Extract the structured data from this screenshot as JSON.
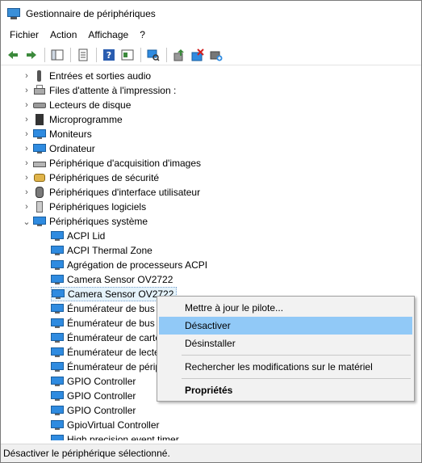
{
  "window": {
    "title": "Gestionnaire de périphériques"
  },
  "menubar": {
    "items": [
      "Fichier",
      "Action",
      "Affichage",
      "?"
    ]
  },
  "toolbar": {
    "buttons": [
      "back-icon",
      "forward-icon",
      "show-hide-tree-icon",
      "properties-icon",
      "help-icon",
      "action-icon",
      "scan-hardware-icon",
      "update-driver-icon",
      "disable-device-icon",
      "install-icon"
    ]
  },
  "tree": {
    "categories": [
      {
        "label": "Entrées et sorties audio",
        "icon": "audio-icon"
      },
      {
        "label": "Files d'attente à l'impression :",
        "icon": "printer-icon"
      },
      {
        "label": "Lecteurs de disque",
        "icon": "disk-icon"
      },
      {
        "label": "Microprogramme",
        "icon": "chip-icon"
      },
      {
        "label": "Moniteurs",
        "icon": "monitor-icon"
      },
      {
        "label": "Ordinateur",
        "icon": "computer-icon"
      },
      {
        "label": "Périphérique d'acquisition d'images",
        "icon": "scanner-icon"
      },
      {
        "label": "Périphériques de sécurité",
        "icon": "key-icon"
      },
      {
        "label": "Périphériques d'interface utilisateur",
        "icon": "hid-icon"
      },
      {
        "label": "Périphériques logiciels",
        "icon": "software-device-icon"
      },
      {
        "label": "Périphériques système",
        "icon": "system-icon"
      }
    ],
    "system_devices": [
      "ACPI Lid",
      "ACPI Thermal Zone",
      "Agrégation de processeurs ACPI",
      "Camera Sensor OV2722",
      "Camera Sensor OV2722",
      "Énumérateur de bus",
      "Énumérateur de bus",
      "Énumérateur de carte",
      "Énumérateur de lecte",
      "Énumérateur de périp",
      "GPIO Controller",
      "GPIO Controller",
      "GPIO Controller",
      "GpioVirtual Controller",
      "High precision event timer"
    ]
  },
  "context_menu": {
    "items": [
      {
        "label": "Mettre à jour le pilote...",
        "highlighted": false,
        "bold": false
      },
      {
        "label": "Désactiver",
        "highlighted": true,
        "bold": false
      },
      {
        "label": "Désinstaller",
        "highlighted": false,
        "bold": false
      },
      {
        "label": "Rechercher les modifications sur le matériel",
        "highlighted": false,
        "bold": false
      },
      {
        "label": "Propriétés",
        "highlighted": false,
        "bold": true
      }
    ]
  },
  "statusbar": {
    "text": "Désactiver le périphérique sélectionné."
  },
  "colors": {
    "highlight": "#91c9f7",
    "selection": "#cce8ff",
    "monitor_blue": "#2f8be0"
  }
}
